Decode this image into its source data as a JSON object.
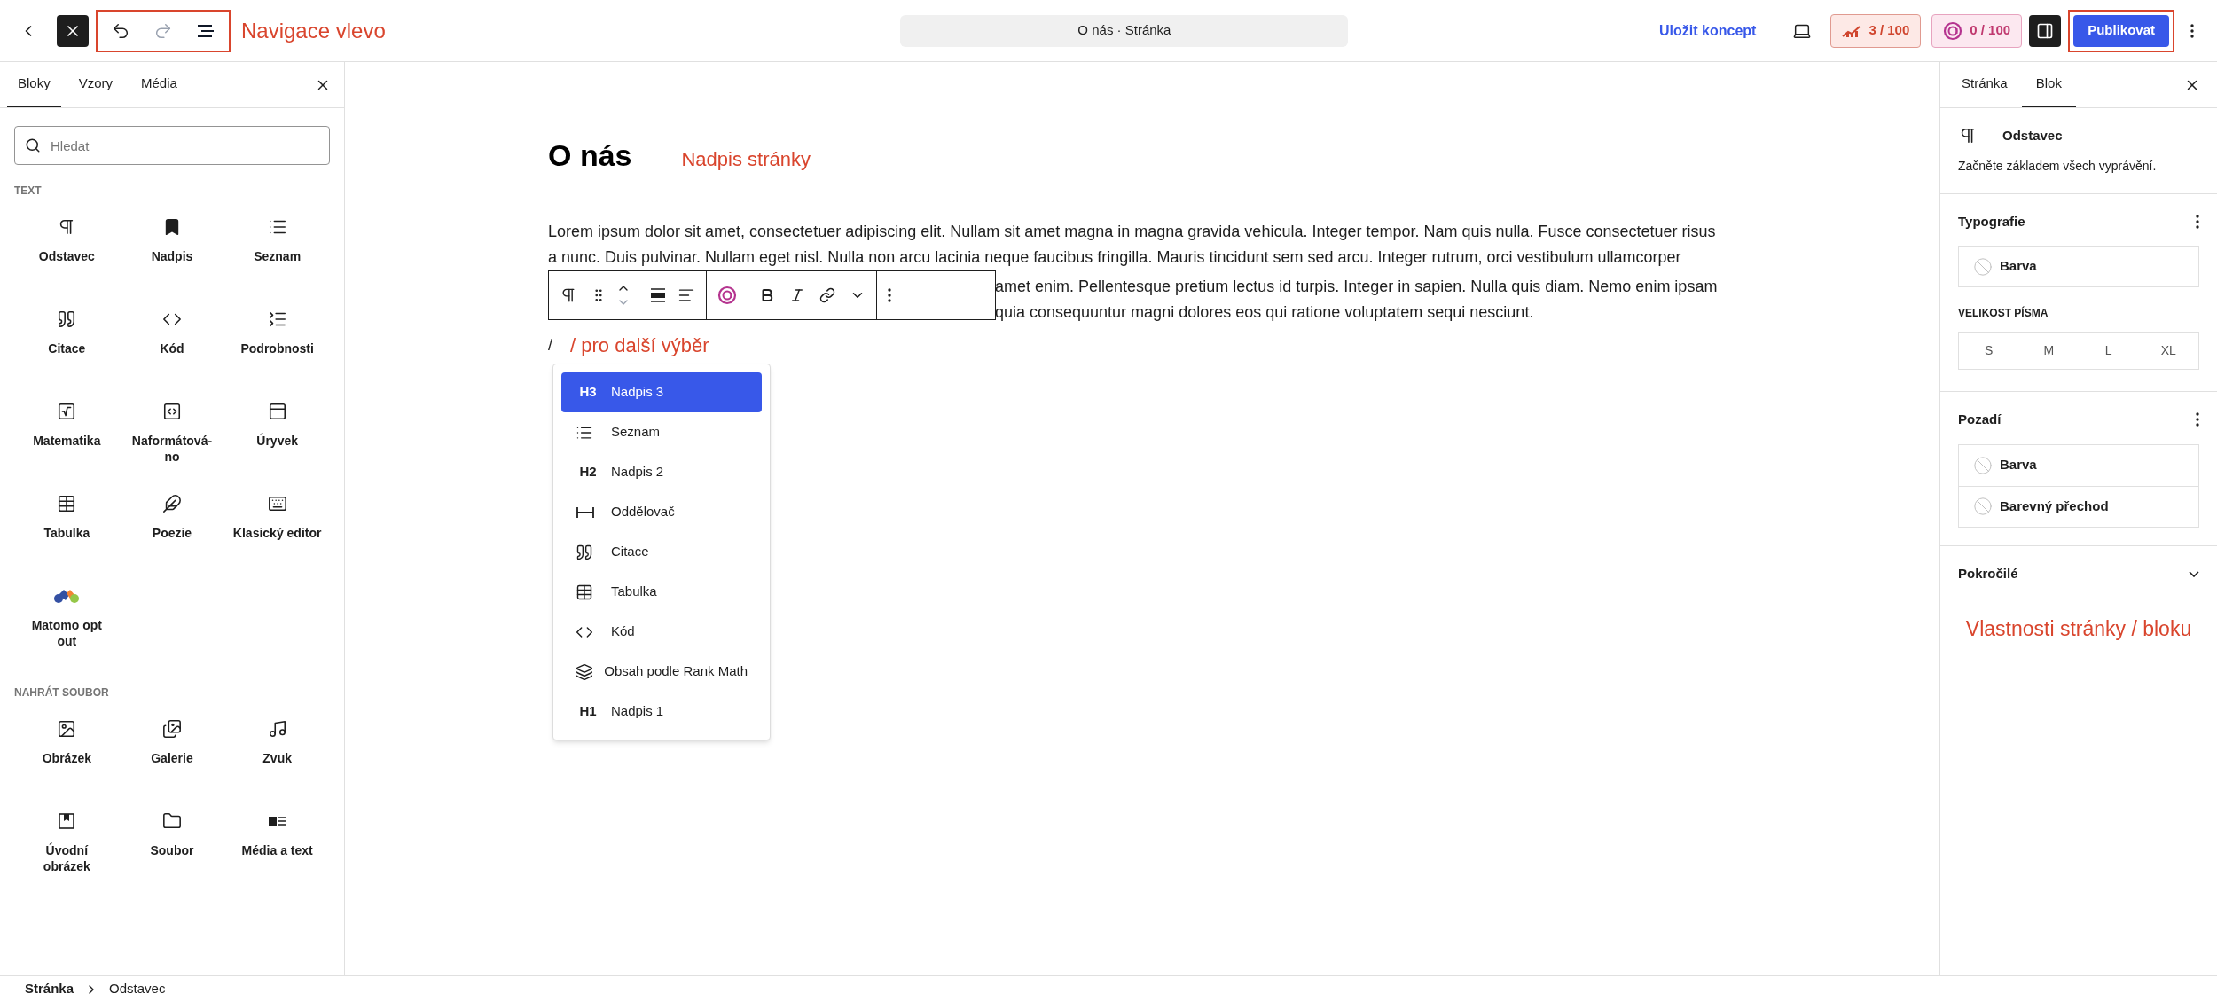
{
  "top_bar": {
    "navigation": {
      "highlighted": true,
      "redo_disabled": true
    },
    "annotation": "Navigace vlevo",
    "document_title": "O nás · Stránka",
    "save_draft": "Uložit koncept",
    "seo_score": "3 / 100",
    "ai_score": "0 / 100",
    "sidebar_toggle_on": true,
    "publish": {
      "label": "Publikovat",
      "highlighted": true
    }
  },
  "inserter": {
    "tabs": [
      {
        "label": "Bloky",
        "selected": true
      },
      {
        "label": "Vzory",
        "selected": false
      },
      {
        "label": "Média",
        "selected": false
      }
    ],
    "search": {
      "placeholder": "Hledat"
    },
    "sections": [
      {
        "title": "TEXT",
        "blocks": [
          "Odstavec",
          "Nadpis",
          "Seznam",
          "Citace",
          "Kód",
          "Podrobnosti",
          "Matematika",
          "Naformátová-no",
          "Úryvek",
          "Tabulka",
          "Poezie",
          "Klasický editor",
          "Matomo opt out"
        ]
      },
      {
        "title": "NAHRÁT SOUBOR",
        "blocks": [
          "Obrázek",
          "Galerie",
          "Zvuk",
          "Úvodní obrázek",
          "Soubor",
          "Média a text"
        ]
      }
    ]
  },
  "editor": {
    "title": "O nás",
    "title_annotation": "Nadpis stránky",
    "paragraph_lines": [
      "Lorem ipsum dolor sit amet, consectetuer adipiscing elit. Nullam sit amet magna in magna gravida vehicula. Integer tempor. Nam quis nulla. Fusce consectetuer risus",
      "a nunc. Duis pulvinar. Nullam eget nisl. Nulla non arcu lacinia neque faucibus fringilla. Mauris tincidunt sem sed arcu. Integer rutrum, orci vestibulum ullamcorper"
    ],
    "covered_lines": [
      "amet enim. Pellentesque pretium lectus id turpis. Integer in sapien. Nulla quis diam. Nemo enim ipsam",
      "quia consequuntur magni dolores eos qui ratione voluptatem sequi nesciunt."
    ],
    "slash": "/",
    "slash_annotation": "/ pro další výběr",
    "suggestions": [
      {
        "kind": "heading",
        "badge": "H3",
        "label": "Nadpis 3",
        "selected": true
      },
      {
        "kind": "list",
        "label": "Seznam",
        "selected": false
      },
      {
        "kind": "heading",
        "badge": "H2",
        "label": "Nadpis 2",
        "selected": false
      },
      {
        "kind": "divider",
        "label": "Oddělovač",
        "selected": false
      },
      {
        "kind": "quote",
        "label": "Citace",
        "selected": false
      },
      {
        "kind": "table",
        "label": "Tabulka",
        "selected": false
      },
      {
        "kind": "code",
        "label": "Kód",
        "selected": false
      },
      {
        "kind": "toc",
        "label": "Obsah podle Rank Math",
        "selected": false
      },
      {
        "kind": "heading",
        "badge": "H1",
        "label": "Nadpis 1",
        "selected": false
      }
    ]
  },
  "settings": {
    "tabs": [
      {
        "label": "Stránka",
        "selected": false
      },
      {
        "label": "Blok",
        "selected": true
      }
    ],
    "block": {
      "name": "Odstavec",
      "description": "Začněte základem všech vyprávění."
    },
    "typography": {
      "title": "Typografie",
      "color_label": "Barva",
      "font_size_label": "VELIKOST PÍSMA",
      "sizes": [
        "S",
        "M",
        "L",
        "XL"
      ]
    },
    "background": {
      "title": "Pozadí",
      "options": [
        "Barva",
        "Barevný přechod"
      ]
    },
    "advanced": {
      "title": "Pokročilé",
      "expanded": false
    },
    "annotation": "Vlastnosti stránky / bloku"
  },
  "breadcrumb": [
    "Stránka",
    "Odstavec"
  ]
}
